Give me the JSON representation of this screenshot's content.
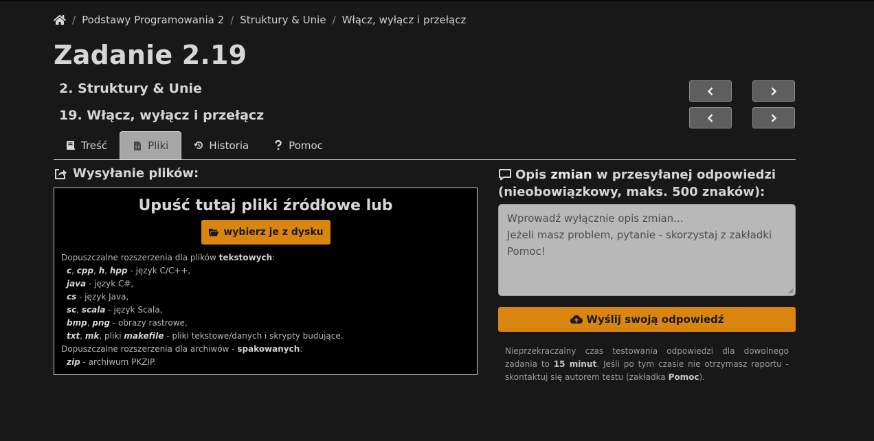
{
  "breadcrumb": {
    "home_icon": "home-icon",
    "items": [
      "Podstawy Programowania 2",
      "Struktury & Unie",
      "Włącz, wyłącz i przełącz"
    ],
    "separator": "/"
  },
  "page_title": "Zadanie 2.19",
  "section_name": "2. Struktury & Unie",
  "task_name": "19. Włącz, wyłącz i przełącz",
  "nav": {
    "prev_section_icon": "chevron-left-icon",
    "next_section_icon": "chevron-right-icon",
    "prev_task_icon": "chevron-left-icon",
    "next_task_icon": "chevron-right-icon"
  },
  "tabs": [
    {
      "label": "Treść",
      "icon": "book-icon",
      "active": false
    },
    {
      "label": "Pliki",
      "icon": "file-code-icon",
      "active": true
    },
    {
      "label": "Historia",
      "icon": "history-icon",
      "active": false
    },
    {
      "label": "Pomoc",
      "icon": "question-icon",
      "active": false
    }
  ],
  "upload": {
    "heading": "Wysyłanie plików:",
    "drop_title": "Upuść tutaj pliki źródłowe lub",
    "choose_button": "wybierz je z dysku",
    "ext_intro_text": "Dopuszczalne rozszerzenia dla plików ",
    "ext_intro_bold": "tekstowych",
    "ext_rows": [
      {
        "exts": [
          "c",
          "cpp",
          "h",
          "hpp"
        ],
        "desc": " - język C/C++,"
      },
      {
        "exts": [
          "java"
        ],
        "desc": " - język C#,"
      },
      {
        "exts": [
          "cs"
        ],
        "desc": " - język Java,"
      },
      {
        "exts": [
          "sc",
          "scala"
        ],
        "desc": " - język Scala,"
      },
      {
        "exts": [
          "bmp",
          "png"
        ],
        "desc": " - obrazy rastrowe,"
      }
    ],
    "txt_row": {
      "ext1": "txt",
      "ext2": "mk",
      "mid": " pliki ",
      "ext3": "makefile",
      "desc": " - pliki tekstowe/danych i skrypty budujące."
    },
    "archive_intro_text": "Dopuszczalne rozszerzenia dla archiwów - ",
    "archive_intro_bold": "spakowanych",
    "zip_ext": "zip",
    "zip_desc": " - archiwum PKZIP."
  },
  "description": {
    "heading_pre": "Opis ",
    "heading_bold": "zmian",
    "heading_post": " w przesyłanej odpowiedzi (nieobowiązkowy, maks. 500 znaków):",
    "placeholder_line1": "Wprowadź wyłącznie opis zmian...",
    "placeholder_line2": "Jeżeli masz problem, pytanie - skorzystaj z zakładki Pomoc!",
    "send_button": "Wyślij swoją odpowiedź",
    "note_pre": "Nieprzekraczalny czas testowania odpowiedzi dla dowolnego zadania to ",
    "note_bold": "15 minut",
    "note_mid": ". Jeśli po tym czasie nie otrzymasz raportu - skontaktuj się autorem testu (zakładka ",
    "note_bold2": "Pomoc",
    "note_post": ")."
  },
  "colors": {
    "background": "#181818",
    "accent": "#d9850f",
    "active_tab": "#a6a6a6",
    "textarea_bg": "#b8b8b8"
  }
}
